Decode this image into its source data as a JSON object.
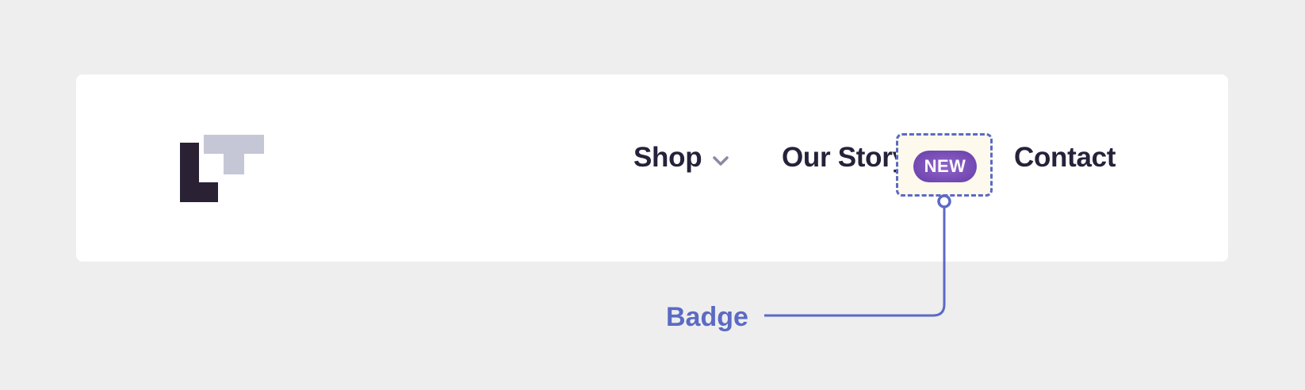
{
  "nav": {
    "items": [
      {
        "label": "Shop",
        "has_dropdown": true
      },
      {
        "label": "Our Story",
        "badge": "NEW"
      },
      {
        "label": "Contact"
      }
    ]
  },
  "callout": {
    "label": "Badge"
  },
  "colors": {
    "background": "#eeeeee",
    "card": "#ffffff",
    "text": "#25223a",
    "logo_dark": "#2a2135",
    "logo_light": "#c5c7d6",
    "badge": "#7a4fb8",
    "accent": "#5b6ac4",
    "highlight_fill": "#fdf9ec"
  },
  "icons": {
    "logo": "lt-logo-icon",
    "dropdown": "chevron-down-icon"
  }
}
